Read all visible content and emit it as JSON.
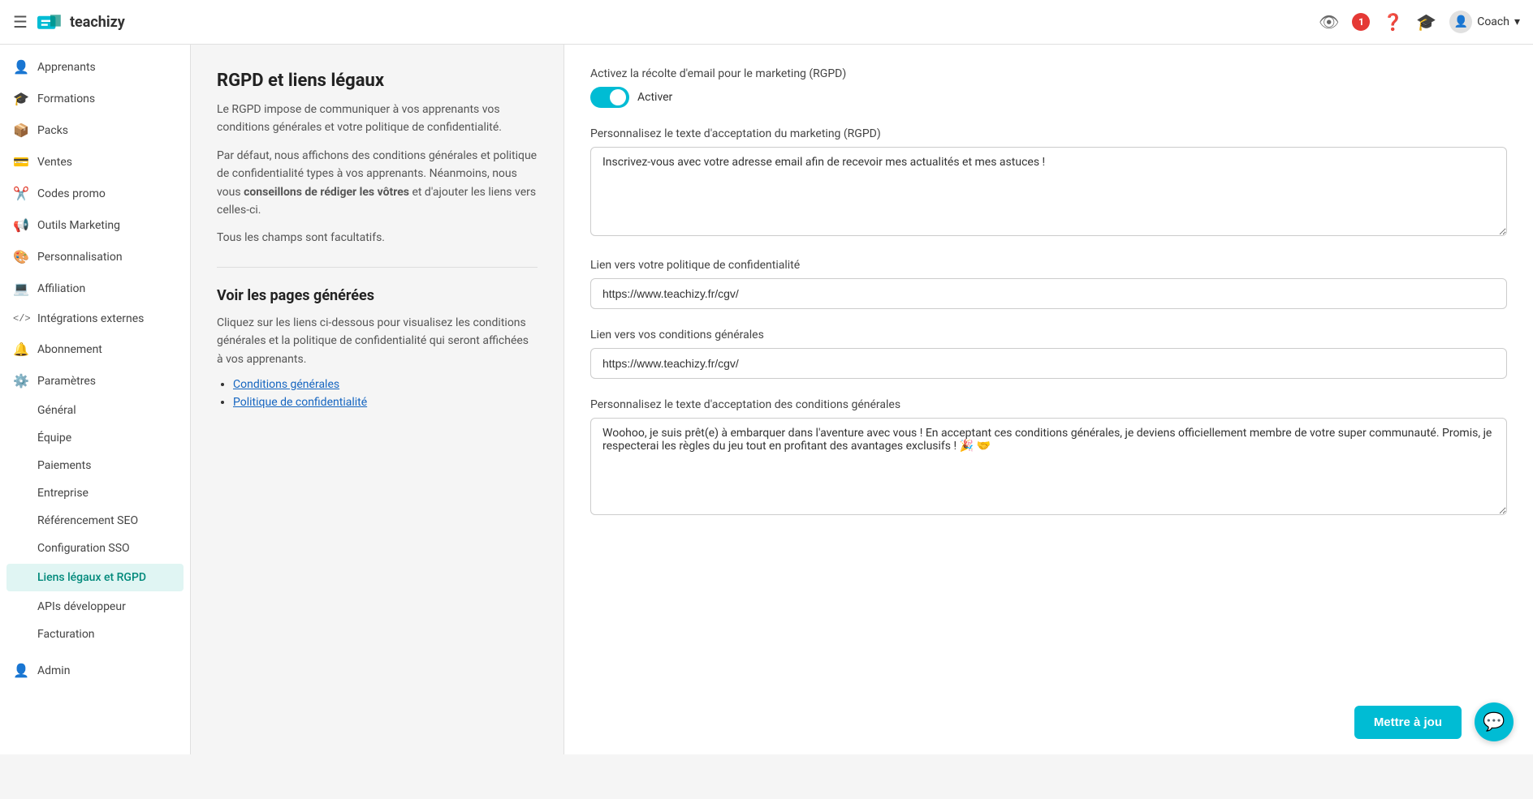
{
  "header": {
    "hamburger": "☰",
    "logo_text": "teachizy",
    "notification_count": "1",
    "coach_label": "Coach",
    "chevron": "▾"
  },
  "sidebar": {
    "items": [
      {
        "id": "apprenants",
        "icon": "👤",
        "label": "Apprenants"
      },
      {
        "id": "formations",
        "icon": "🎓",
        "label": "Formations"
      },
      {
        "id": "packs",
        "icon": "📦",
        "label": "Packs"
      },
      {
        "id": "ventes",
        "icon": "💳",
        "label": "Ventes"
      },
      {
        "id": "codes-promo",
        "icon": "✂️",
        "label": "Codes promo"
      },
      {
        "id": "outils-marketing",
        "icon": "📢",
        "label": "Outils Marketing"
      },
      {
        "id": "personnalisation",
        "icon": "🎨",
        "label": "Personnalisation"
      },
      {
        "id": "affiliation",
        "icon": "💻",
        "label": "Affiliation"
      },
      {
        "id": "integrations",
        "icon": "</>",
        "label": "Intégrations externes"
      },
      {
        "id": "abonnement",
        "icon": "🔔",
        "label": "Abonnement"
      },
      {
        "id": "parametres",
        "icon": "⚙️",
        "label": "Paramètres"
      }
    ],
    "submenu": [
      {
        "id": "general",
        "label": "Général"
      },
      {
        "id": "equipe",
        "label": "Équipe"
      },
      {
        "id": "paiements",
        "label": "Paiements"
      },
      {
        "id": "entreprise",
        "label": "Entreprise"
      },
      {
        "id": "referencement-seo",
        "label": "Référencement SEO"
      },
      {
        "id": "configuration-sso",
        "label": "Configuration SSO"
      },
      {
        "id": "liens-legaux-rgpd",
        "label": "Liens légaux et RGPD",
        "active": true
      },
      {
        "id": "apis-developpeur",
        "label": "APIs développeur"
      },
      {
        "id": "facturation",
        "label": "Facturation"
      }
    ],
    "admin": {
      "icon": "👤",
      "label": "Admin"
    }
  },
  "left_panel": {
    "title": "RGPD et liens légaux",
    "desc1": "Le RGPD impose de communiquer à vos apprenants vos conditions générales et votre politique de confidentialité.",
    "desc2_pre": "Par défaut, nous affichons des conditions générales et politique de confidentialité types à vos apprenants. Néanmoins, nous vous ",
    "desc2_bold": "conseillons de rédiger les vôtres",
    "desc2_post": " et d'ajouter les liens vers celles-ci.",
    "desc3": "Tous les champs sont facultatifs.",
    "section2_title": "Voir les pages générées",
    "section2_desc": "Cliquez sur les liens ci-dessous pour visualisez les conditions générales et la politique de confidentialité qui seront affichées à vos apprenants.",
    "link1": "Conditions générales",
    "link2": "Politique de confidentialité"
  },
  "right_panel": {
    "label1": "Activez la récolte d'email pour le marketing (RGPD)",
    "toggle_label": "Activer",
    "label2": "Personnalisez le texte d'acceptation du marketing (RGPD)",
    "textarea1_value": "Inscrivez-vous avec votre adresse email afin de recevoir mes actualités et mes astuces !",
    "label3": "Lien vers votre politique de confidentialité",
    "input1_value": "https://www.teachizy.fr/cgv/",
    "label4": "Lien vers vos conditions générales",
    "input2_value": "https://www.teachizy.fr/cgv/",
    "label5": "Personnalisez le texte d'acceptation des conditions générales",
    "textarea2_value": "Woohoo, je suis prêt(e) à embarquer dans l'aventure avec vous ! En acceptant ces conditions générales, je deviens officiellement membre de votre super communauté. Promis, je respecterai les règles du jeu tout en profitant des avantages exclusifs ! 🎉 🤝",
    "save_btn": "Mettre à jou"
  }
}
